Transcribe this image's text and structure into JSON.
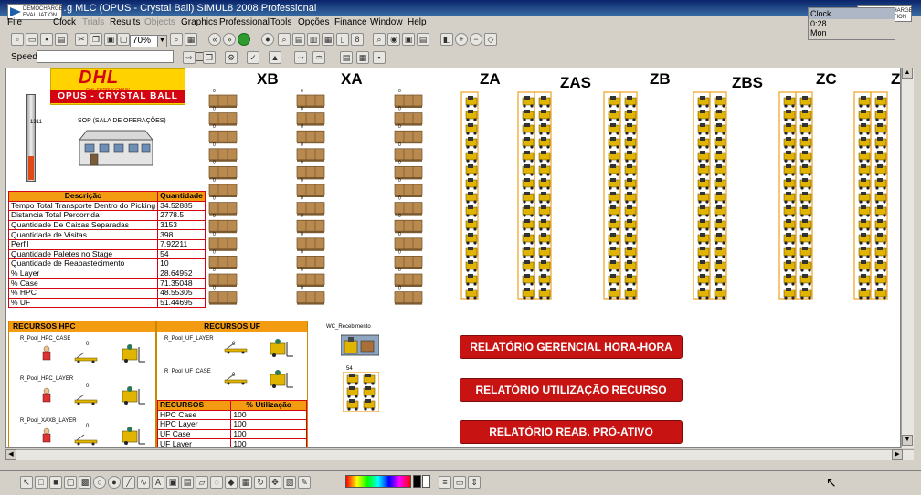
{
  "window": {
    "title": "…g MLC (OPUS - Crystal Ball)  SIMUL8 2008 Professional",
    "demo_badge_left": "DEMOCHARGE EVALUATION",
    "demo_badge_right": "DEMOCHARGE EVALUATION"
  },
  "menu": [
    {
      "label": "File",
      "disabled": false
    },
    {
      "label": "Clock",
      "disabled": false
    },
    {
      "label": "Trials",
      "disabled": true
    },
    {
      "label": "Results",
      "disabled": false
    },
    {
      "label": "Objects",
      "disabled": true
    },
    {
      "label": "Graphics",
      "disabled": false
    },
    {
      "label": "Professional",
      "disabled": false
    },
    {
      "label": "Tools",
      "disabled": false
    },
    {
      "label": "Opções",
      "disabled": false
    },
    {
      "label": "Finance",
      "disabled": false
    },
    {
      "label": "Window",
      "disabled": false
    },
    {
      "label": "Help",
      "disabled": false
    }
  ],
  "clock": {
    "header": "Clock",
    "time": "0:28",
    "day": "Mon"
  },
  "toolbar": {
    "zoom": "70%",
    "speed_label": "Speed:"
  },
  "logo": {
    "brand": "DHL",
    "tagline": "DHL SUPPLY CHAIN",
    "product": "OPUS - CRYSTAL BALL"
  },
  "gauge": {
    "value_label": "1311",
    "fill_fraction": 0.28
  },
  "sop_label": "SOP (SALA DE OPERAÇÕES)",
  "columns": [
    "XB",
    "XA",
    "ZA",
    "ZAS",
    "ZB",
    "ZBS",
    "ZC",
    "Z"
  ],
  "stats_table": {
    "headers": [
      "Descrição",
      "Quantidade"
    ],
    "rows": [
      [
        "Tempo Total Transporte Dentro do Picking",
        "34.52885"
      ],
      [
        "Distancia Total Percorrida",
        "2778.5"
      ],
      [
        "Quantidade De Caixas Separadas",
        "3153"
      ],
      [
        "Quantidade de Visitas",
        "398"
      ],
      [
        "Perfil",
        "7.92211"
      ],
      [
        "Quantidade Paletes no Stage",
        "54"
      ],
      [
        "Quantidade de Reabastecimento",
        "10"
      ],
      [
        "% Layer",
        "28.64952"
      ],
      [
        "% Case",
        "71.35048"
      ],
      [
        "% HPC",
        "48.55305"
      ],
      [
        "% UF",
        "51.44695"
      ]
    ]
  },
  "resources_hpc": {
    "title": "RECURSOS HPC",
    "pools": [
      {
        "name": "R_Pool_HPC_CASE",
        "count": "0"
      },
      {
        "name": "R_Pool_HPC_LAYER",
        "count": "0"
      },
      {
        "name": "R_Pool_XAXB_LAYER",
        "count": "0"
      }
    ]
  },
  "resources_uf": {
    "title": "RECURSOS UF",
    "pools": [
      {
        "name": "R_Pool_UF_LAYER",
        "count": "0"
      },
      {
        "name": "R_Pool_UF_CASE",
        "count": "0"
      }
    ]
  },
  "util_table": {
    "headers": [
      "RECURSOS",
      "% Utilização"
    ],
    "rows": [
      [
        "HPC Case",
        "100"
      ],
      [
        "HPC Layer",
        "100"
      ],
      [
        "UF Case",
        "100"
      ],
      [
        "UF Layer",
        "100"
      ]
    ]
  },
  "wc_label": "WC_Recebimento",
  "wc_count": "54",
  "buttons": {
    "report_hourly": "RELATÓRIO GERENCIAL HORA-HORA",
    "report_resource": "RELATÓRIO UTILIZAÇÃO RECURSO",
    "report_replenish": "RELATÓRIO REAB. PRÓ-ATIVO"
  },
  "queue_count": "0",
  "colors": {
    "dhl_yellow": "#ffd200",
    "dhl_red": "#d40511",
    "header_orange": "#f39c12",
    "button_red": "#c81313",
    "forklift_yellow": "#e0b400",
    "rack_orange": "#f0a020"
  }
}
